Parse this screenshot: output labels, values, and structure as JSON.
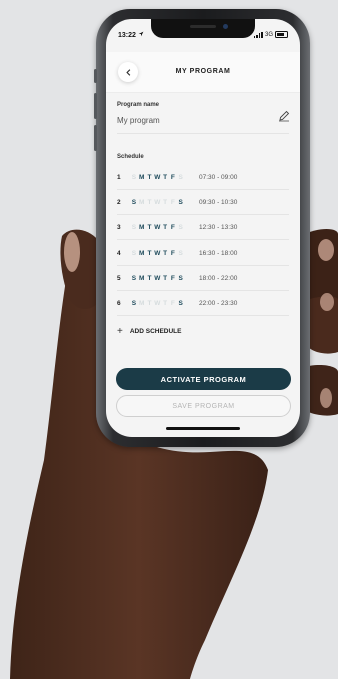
{
  "status_bar": {
    "time": "13:22",
    "network": "3G"
  },
  "header": {
    "title": "MY PROGRAM"
  },
  "program_name": {
    "label": "Program name",
    "value": "My program"
  },
  "schedule": {
    "label": "Schedule",
    "rows": [
      {
        "num": "1",
        "days": [
          "S",
          "M",
          "T",
          "W",
          "T",
          "F",
          "S"
        ],
        "active": [
          false,
          true,
          true,
          true,
          true,
          true,
          false
        ],
        "time": "07:30 - 09:00"
      },
      {
        "num": "2",
        "days": [
          "S",
          "M",
          "T",
          "W",
          "T",
          "F",
          "S"
        ],
        "active": [
          true,
          false,
          false,
          false,
          false,
          false,
          true
        ],
        "time": "09:30 - 10:30"
      },
      {
        "num": "3",
        "days": [
          "S",
          "M",
          "T",
          "W",
          "T",
          "F",
          "S"
        ],
        "active": [
          false,
          true,
          true,
          true,
          true,
          true,
          false
        ],
        "time": "12:30 - 13:30"
      },
      {
        "num": "4",
        "days": [
          "S",
          "M",
          "T",
          "W",
          "T",
          "F",
          "S"
        ],
        "active": [
          false,
          true,
          true,
          true,
          true,
          true,
          false
        ],
        "time": "16:30 - 18:00"
      },
      {
        "num": "5",
        "days": [
          "S",
          "M",
          "T",
          "W",
          "T",
          "F",
          "S"
        ],
        "active": [
          true,
          true,
          true,
          true,
          true,
          true,
          true
        ],
        "time": "18:00 - 22:00"
      },
      {
        "num": "6",
        "days": [
          "S",
          "M",
          "T",
          "W",
          "T",
          "F",
          "S"
        ],
        "active": [
          true,
          false,
          false,
          false,
          false,
          false,
          true
        ],
        "time": "22:00 - 23:30"
      }
    ],
    "add_label": "ADD SCHEDULE"
  },
  "buttons": {
    "activate": "ACTIVATE PROGRAM",
    "save": "SAVE PROGRAM"
  },
  "colors": {
    "accent": "#1b3b47",
    "day_on": "#1f4b5c",
    "day_off": "#d6dcde",
    "background": "#e3e4e6"
  }
}
